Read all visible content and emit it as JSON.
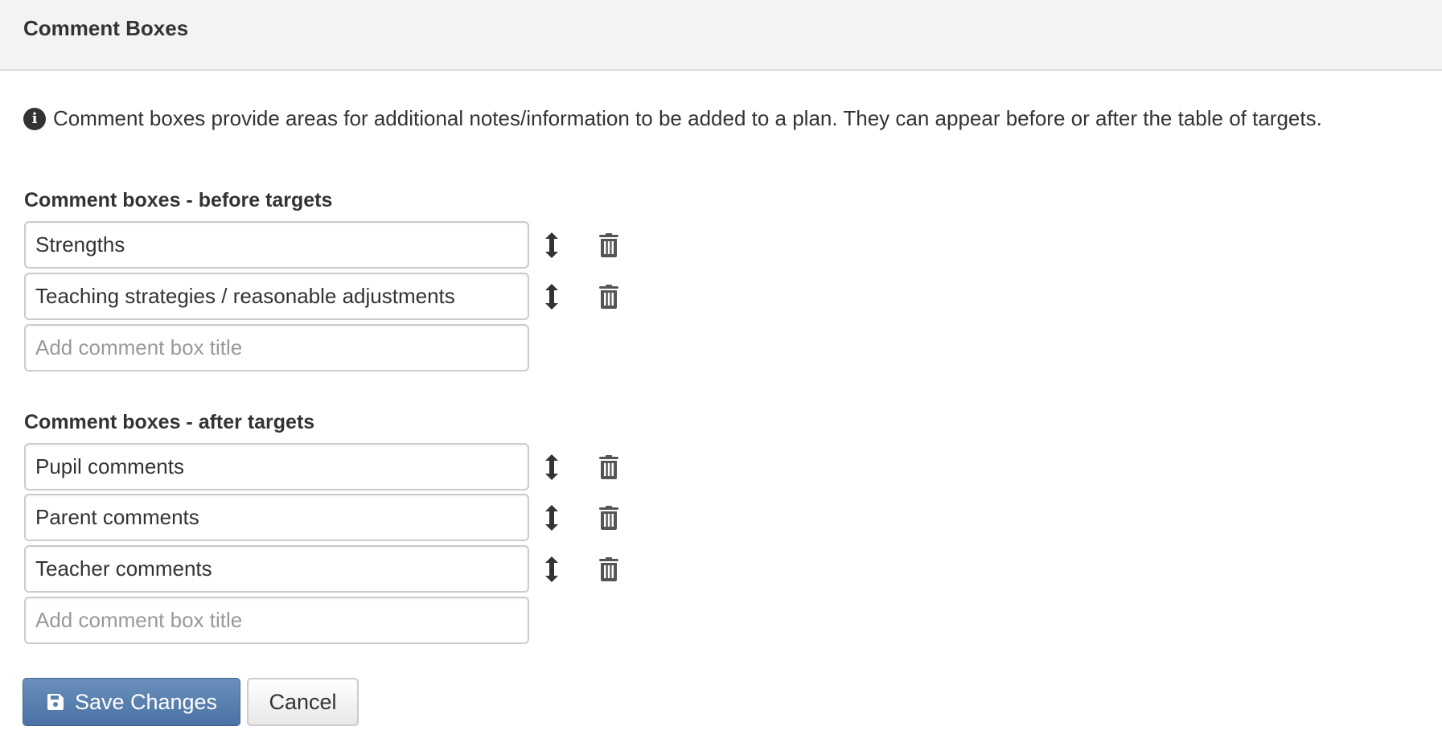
{
  "header": {
    "title": "Comment Boxes"
  },
  "info": {
    "icon": "info-circle-icon",
    "text": "Comment boxes provide areas for additional notes/information to be added to a plan. They can appear before or after the table of targets."
  },
  "before": {
    "label": "Comment boxes - before targets",
    "items": [
      {
        "value": "Strengths"
      },
      {
        "value": "Teaching strategies / reasonable adjustments"
      }
    ],
    "new_placeholder": "Add comment box title"
  },
  "after": {
    "label": "Comment boxes - after targets",
    "items": [
      {
        "value": "Pupil comments"
      },
      {
        "value": "Parent comments"
      },
      {
        "value": "Teacher comments"
      }
    ],
    "new_placeholder": "Add comment box title"
  },
  "actions": {
    "save_label": "Save Changes",
    "cancel_label": "Cancel"
  },
  "colors": {
    "primary": "#4a72a3",
    "header_bg": "#f3f3f5",
    "text": "#333333"
  }
}
